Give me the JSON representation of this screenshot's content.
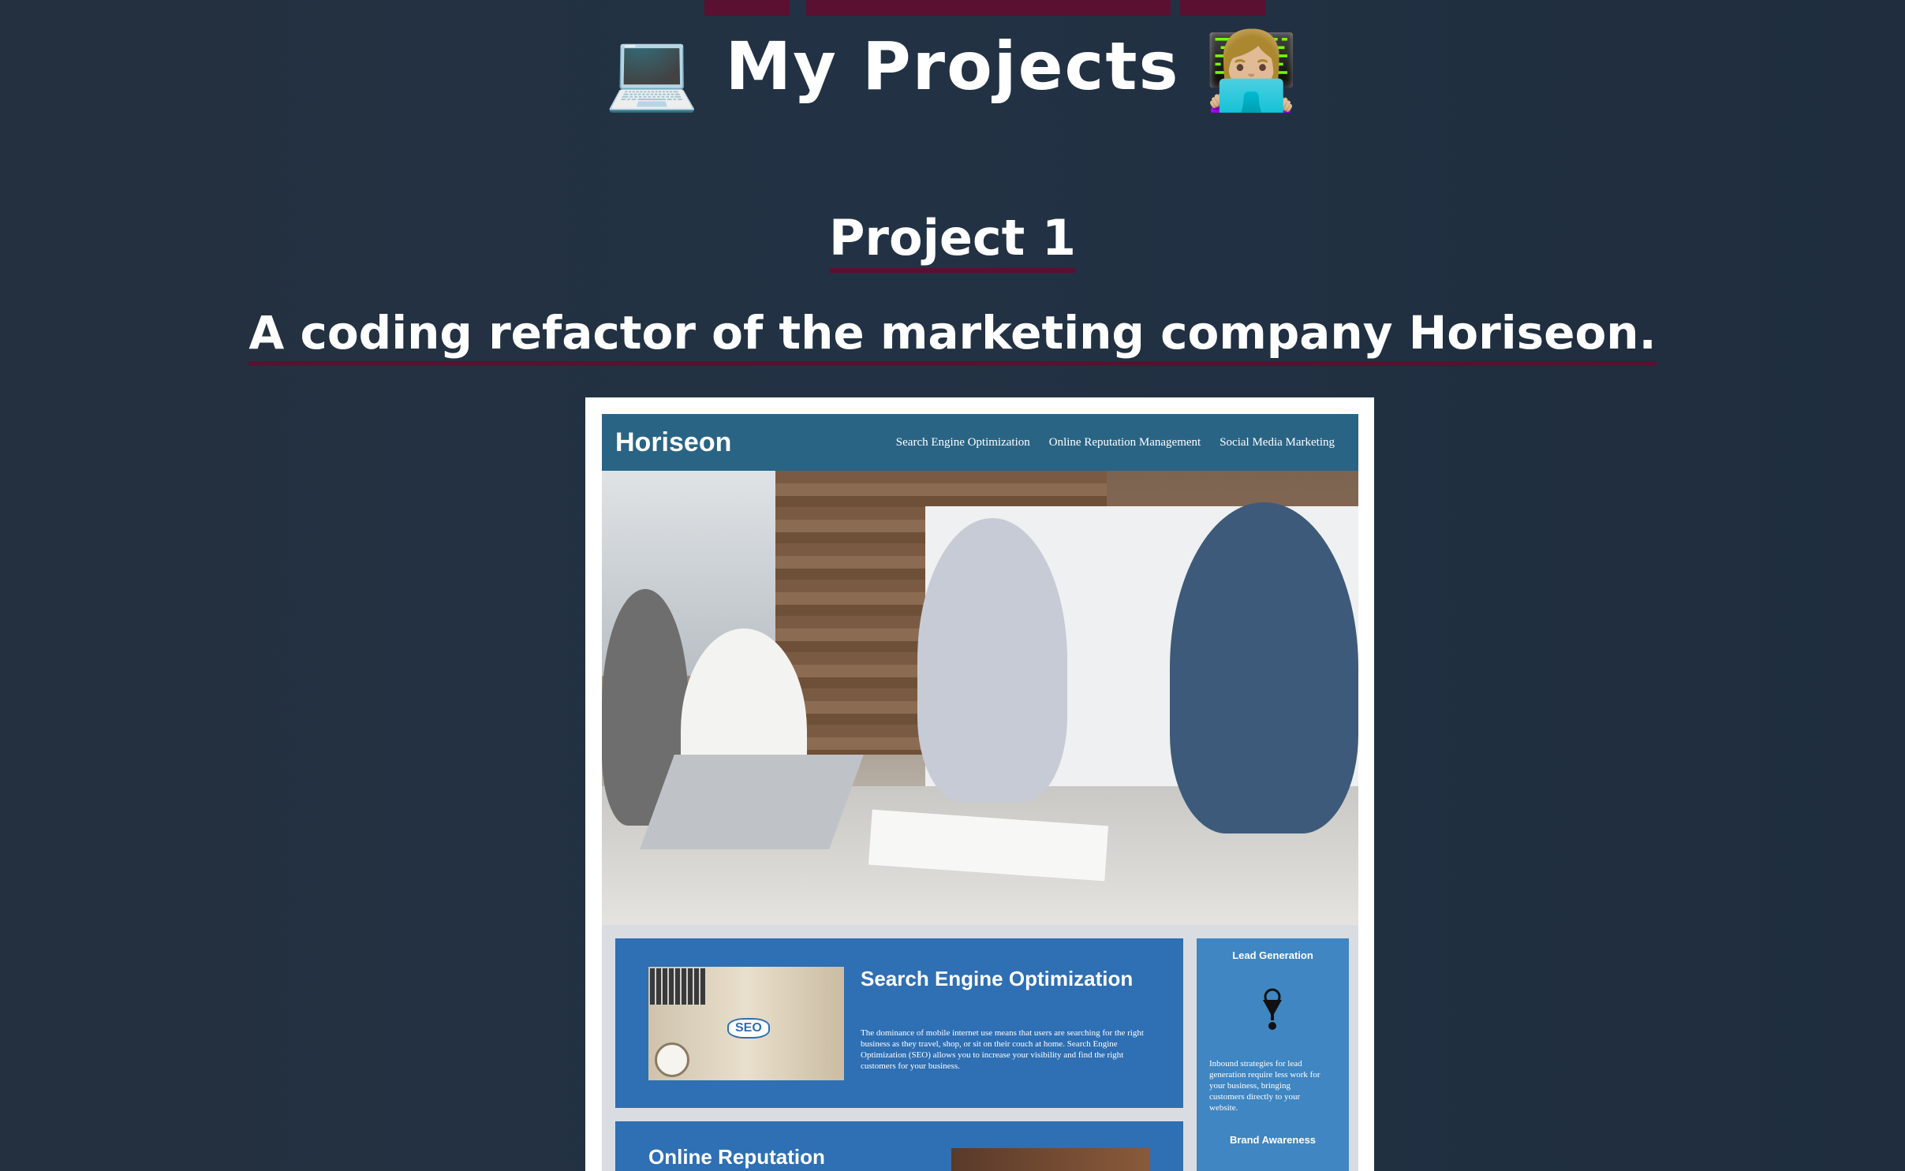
{
  "header": {
    "title": "My Projects",
    "left_emoji": "💻",
    "right_emoji": "👩🏼‍💻"
  },
  "section": {
    "heading": "Project 1",
    "description": "A coding refactor of the marketing company Horiseon."
  },
  "preview": {
    "logo": "Horiseon",
    "nav": [
      "Search Engine Optimization",
      "Online Reputation Management",
      "Social Media Marketing"
    ],
    "seo_card": {
      "title": "Search Engine Optimization",
      "body": "The dominance of mobile internet use means that users are searching for the right business as they travel, shop, or sit on their couch at home. Search Engine Optimization (SEO) allows you to increase your visibility and find the right customers for your business.",
      "badge": "SEO"
    },
    "orm_card": {
      "title": "Online Reputation"
    },
    "sidebar": {
      "lead_title": "Lead Generation",
      "lead_body": "Inbound strategies for lead generation require less work for your business, bringing customers directly to your website.",
      "brand_title": "Brand Awareness"
    }
  },
  "colors": {
    "background": "#223244",
    "accent_underline": "#5a1030",
    "site_header": "#2a6485",
    "card_blue": "#2f6fb3",
    "sidebar_blue": "#3f86c2"
  }
}
